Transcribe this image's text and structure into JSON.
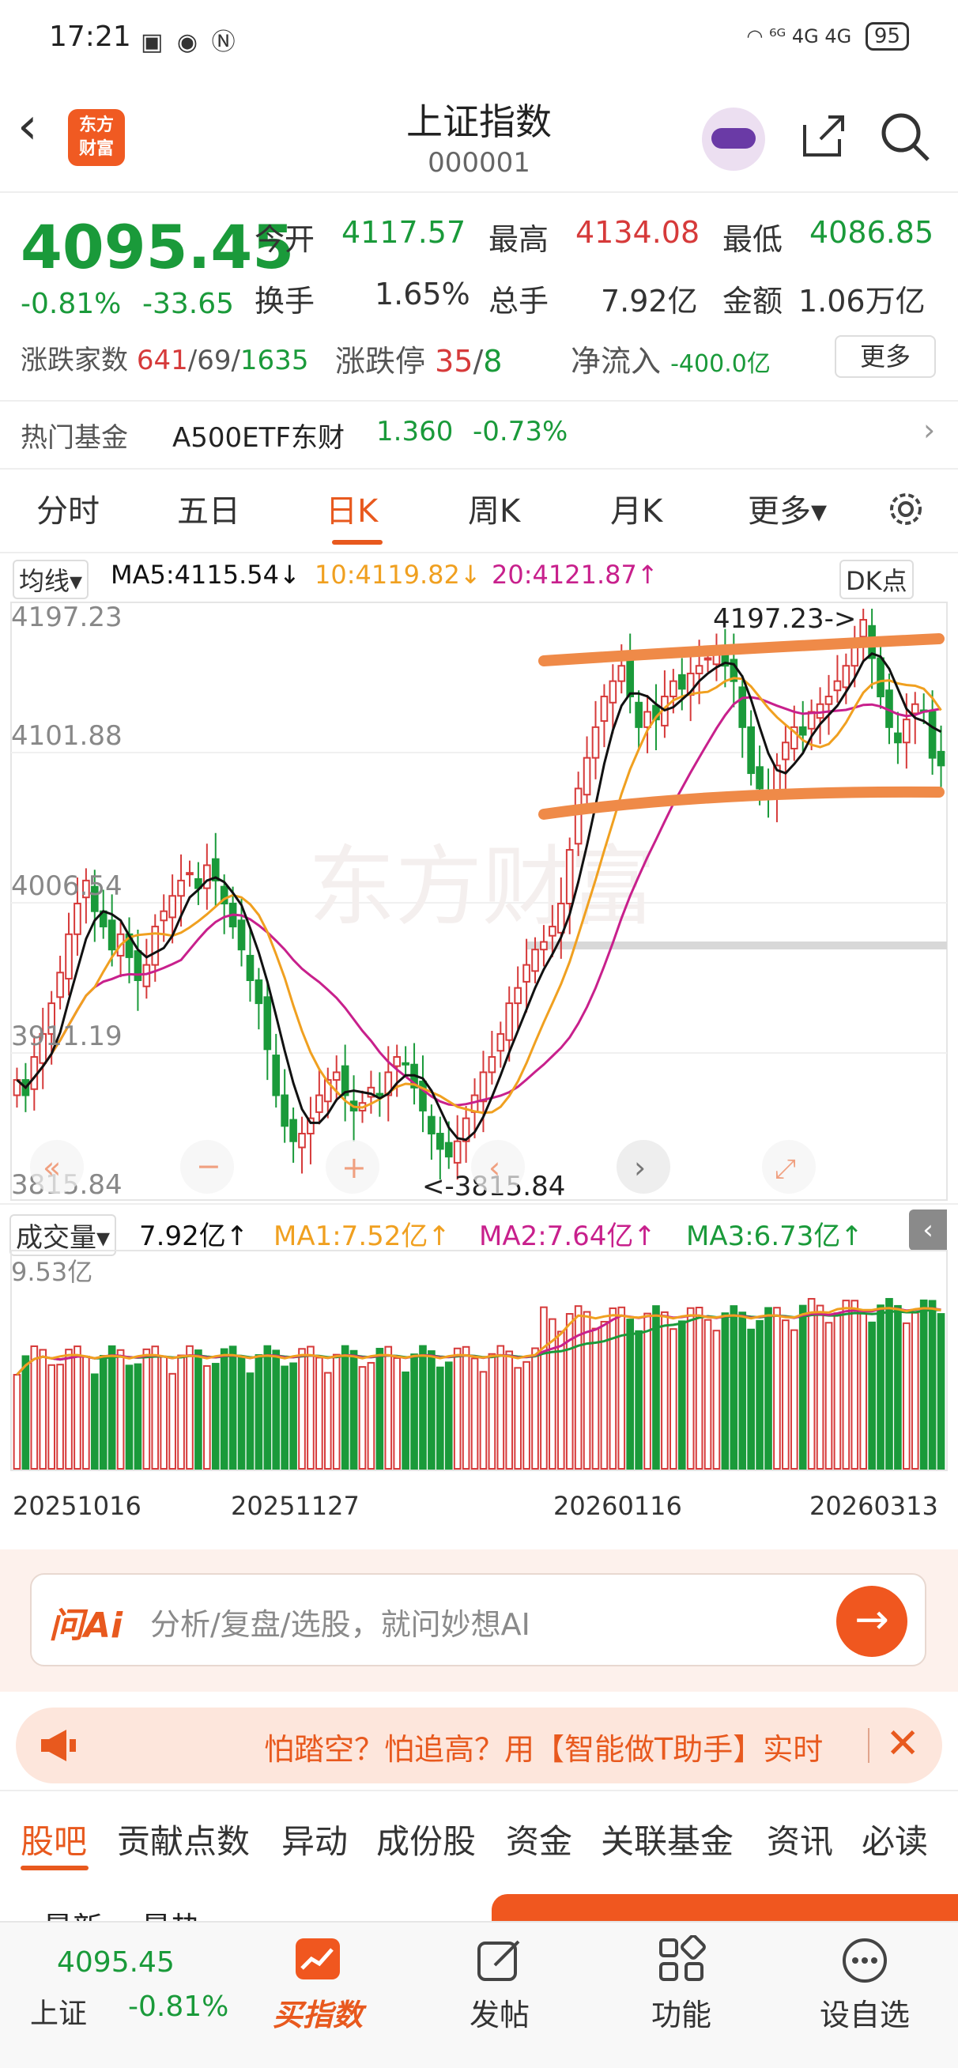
{
  "status_bar": {
    "time": "17:21",
    "icons": [
      "app-notification-icon",
      "eye-icon",
      "nfc-icon"
    ],
    "right_text": "⁶ᴳ 4G 4G",
    "battery": "95"
  },
  "header": {
    "title": "上证指数",
    "code": "000001",
    "logo_text": "东方财富"
  },
  "quote": {
    "price": "4095.45",
    "change_pct": "-0.81%",
    "change_abs": "-33.65",
    "fields": [
      {
        "label": "今开",
        "value": "4117.57"
      },
      {
        "label": "最高",
        "value": "4134.08"
      },
      {
        "label": "最低",
        "value": "4086.85"
      },
      {
        "label": "换手",
        "value": "1.65%"
      },
      {
        "label": "总手",
        "value": "7.92亿"
      },
      {
        "label": "金额",
        "value": "1.06万亿"
      }
    ],
    "breadth_label": "涨跌家数",
    "breadth_up": "641",
    "breadth_flat": "69",
    "breadth_down": "1635",
    "limit_label": "涨跌停",
    "limit_up": "35",
    "limit_down": "8",
    "inflow_label": "净流入",
    "inflow_value": "-400.0亿",
    "more_label": "更多"
  },
  "hot_fund": {
    "label": "热门基金",
    "name": "A500ETF东财",
    "price": "1.360",
    "pct": "-0.73%"
  },
  "period_tabs": [
    "分时",
    "五日",
    "日K",
    "周K",
    "月K",
    "更多▾"
  ],
  "active_tab": "日K",
  "ma_bar": {
    "selector": "均线▾",
    "ma5": "MA5:4115.54↓",
    "ma10": "10:4119.82↓",
    "ma20": "20:4121.87↑",
    "dk": "DK点"
  },
  "price_axis": [
    "4197.23",
    "4101.88",
    "4006.54",
    "3911.19",
    "3815.84"
  ],
  "annotations": {
    "high": "4197.23->",
    "low": "<-3815.84",
    "watermark": "东方财富"
  },
  "volume_bar": {
    "selector": "成交量▾",
    "vol": "7.92亿↑",
    "ma1": "MA1:7.52亿↑",
    "ma2": "MA2:7.64亿↑",
    "ma3": "MA3:6.73亿↑",
    "axis_max": "9.53亿"
  },
  "dates": [
    "20251016",
    "20251127",
    "20260116",
    "20260313"
  ],
  "ai": {
    "logo": "问Ai",
    "placeholder": "分析/复盘/选股，就问妙想AI"
  },
  "banner": {
    "text": "怕踏空？怕追高？用【智能做T助手】实时"
  },
  "sub_tabs": [
    "股吧",
    "贡献点数",
    "异动",
    "成份股",
    "资金",
    "关联基金",
    "资讯",
    "必读"
  ],
  "partial_tabs": [
    "最新",
    "最热"
  ],
  "bottom_nav": {
    "price": "4095.45",
    "name": "上证",
    "pct": "-0.81%",
    "items": [
      "买指数",
      "发帖",
      "功能",
      "设自选"
    ]
  },
  "colors": {
    "up": "#d63a3a",
    "down": "#1a9a3a",
    "accent": "#e8591e",
    "ma5": "#111111",
    "ma10": "#f0a020",
    "ma20": "#c8208c"
  },
  "chart_data": {
    "type": "candlestick",
    "ylim": [
      3815.84,
      4197.23
    ],
    "close": [
      3890,
      3880,
      3905,
      3920,
      3940,
      3960,
      3985,
      4005,
      4020,
      4000,
      3990,
      3975,
      3985,
      3970,
      3955,
      3965,
      3990,
      4000,
      4010,
      4020,
      4025,
      4015,
      4030,
      4020,
      4005,
      3990,
      3975,
      3955,
      3940,
      3910,
      3880,
      3860,
      3850,
      3855,
      3865,
      3880,
      3890,
      3895,
      3880,
      3870,
      3875,
      3885,
      3880,
      3895,
      3905,
      3900,
      3885,
      3870,
      3855,
      3845,
      3840,
      3850,
      3865,
      3880,
      3895,
      3905,
      3920,
      3940,
      3950,
      3965,
      3975,
      3980,
      3990,
      4005,
      4040,
      4080,
      4100,
      4120,
      4140,
      4150,
      4160,
      4140,
      4120,
      4130,
      4125,
      4140,
      4150,
      4145,
      4155,
      4160,
      4165,
      4170,
      4160,
      4150,
      4120,
      4090,
      4080,
      4075,
      4095,
      4110,
      4120,
      4115,
      4130,
      4135,
      4140,
      4150,
      4160,
      4175,
      4190,
      4165,
      4140,
      4120,
      4110,
      4125,
      4135,
      4130,
      4100,
      4095
    ]
  }
}
